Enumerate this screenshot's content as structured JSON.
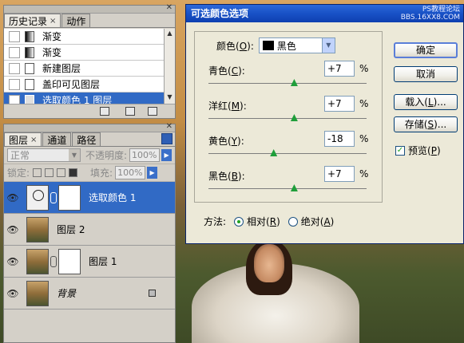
{
  "history_panel": {
    "tabs": [
      {
        "label": "历史记录",
        "close": "×"
      },
      {
        "label": "动作"
      }
    ],
    "items": [
      {
        "label": "渐变",
        "icon": "gradient-icon"
      },
      {
        "label": "渐变",
        "icon": "gradient-icon"
      },
      {
        "label": "新建图层",
        "icon": "doc-icon"
      },
      {
        "label": "盖印可见图层",
        "icon": "doc-icon"
      },
      {
        "label": "选取颜色 1 图层",
        "icon": "doc-icon",
        "selected": true
      }
    ]
  },
  "layers_panel": {
    "tabs": [
      {
        "label": "图层",
        "close": "×"
      },
      {
        "label": "通道"
      },
      {
        "label": "路径"
      }
    ],
    "blend_mode": "正常",
    "opacity_label": "不透明度:",
    "opacity_value": "100%",
    "lock_label": "锁定:",
    "fill_label": "填充:",
    "fill_value": "100%",
    "layers": [
      {
        "name": "选取颜色 1",
        "selected": true
      },
      {
        "name": "图层 2"
      },
      {
        "name": "图层 1"
      },
      {
        "name": "背景"
      }
    ]
  },
  "dialog": {
    "title": "可选颜色选项",
    "watermark_line1": "PS教程论坛",
    "watermark_line2": "BBS.16XX8.COM",
    "colors_label": "颜色(",
    "colors_key": "O",
    "colors_value": "黑色",
    "sliders": [
      {
        "label_pre": "青色(",
        "key": "C",
        "value": "+7",
        "unit": "%",
        "fraction": 0.54
      },
      {
        "label_pre": "洋红(",
        "key": "M",
        "value": "+7",
        "unit": "%",
        "fraction": 0.54
      },
      {
        "label_pre": "黄色(",
        "key": "Y",
        "value": "-18",
        "unit": "%",
        "fraction": 0.41
      },
      {
        "label_pre": "黑色(",
        "key": "B",
        "value": "+7",
        "unit": "%",
        "fraction": 0.54
      }
    ],
    "buttons": {
      "ok": "确定",
      "cancel": "取消",
      "load_pre": "载入(",
      "load_key": "L",
      "load_post": ")...",
      "save_pre": "存储(",
      "save_key": "S",
      "save_post": ")..."
    },
    "preview_pre": "预览(",
    "preview_key": "P",
    "method_label": "方法:",
    "relative_pre": "相对(",
    "relative_key": "R",
    "absolute_pre": "绝对(",
    "absolute_key": "A"
  }
}
